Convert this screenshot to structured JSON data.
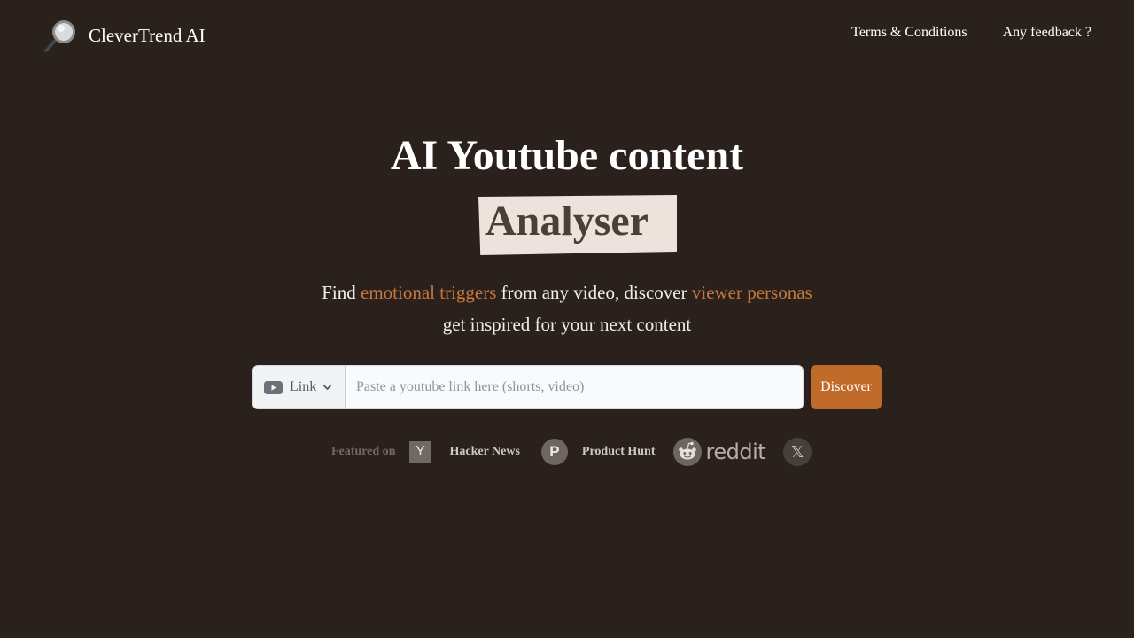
{
  "header": {
    "brand_name": "CleverTrend AI",
    "brand_icon": "magnifying-glass-icon",
    "nav": {
      "terms": "Terms & Conditions",
      "feedback": "Any feedback ?"
    }
  },
  "hero": {
    "title_line1": "AI Youtube content",
    "title_highlight": "Analyser",
    "subtitle": {
      "part1": "Find ",
      "accent1": "emotional triggers",
      "part2": " from any video, discover ",
      "accent2": "viewer personas",
      "line2": "get inspired for your next content"
    }
  },
  "search": {
    "source_select": {
      "selected": "Link",
      "icon": "youtube-icon"
    },
    "input_value": "",
    "input_placeholder": "Paste a youtube link here (shorts, video)",
    "button_label": "Discover"
  },
  "featured": {
    "label": "Featured on",
    "hacker_news": {
      "icon_letter": "Y",
      "label": "Hacker News"
    },
    "product_hunt": {
      "icon_letter": "P",
      "label": "Product Hunt"
    },
    "reddit": {
      "wordmark": "reddit",
      "icon": "reddit-icon"
    },
    "x": {
      "glyph": "𝕏",
      "icon": "x-logo-icon"
    }
  },
  "colors": {
    "background": "#2a211c",
    "accent": "#c8783a",
    "button": "#c06b2a",
    "highlight_bg": "#ede2dc",
    "highlight_text": "#4a3f39"
  }
}
